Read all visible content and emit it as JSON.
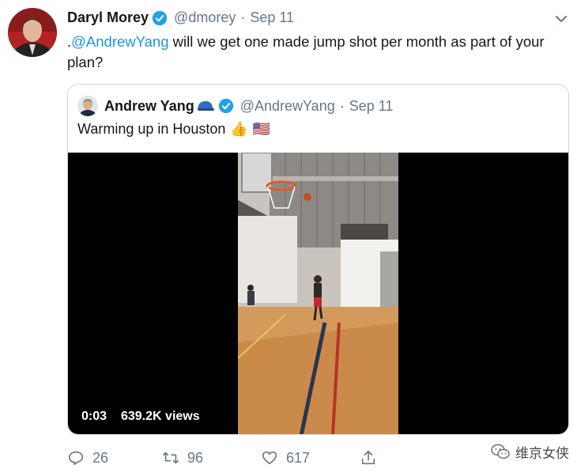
{
  "tweet": {
    "author_name": "Daryl Morey",
    "author_handle": "@dmorey",
    "separator": "·",
    "date": "Sep 11",
    "text_prefix": ".",
    "mention": "@AndrewYang",
    "text_body": " will we get one made jump shot per month as part of your plan?"
  },
  "quoted_tweet": {
    "author_name": "Andrew Yang",
    "author_handle": "@AndrewYang",
    "separator": "·",
    "date": "Sep 11",
    "text": "Warming up in Houston",
    "emoji_1": "👍",
    "emoji_2": "🇺🇸"
  },
  "video": {
    "duration": "0:03",
    "views": "639.2K views"
  },
  "actions": {
    "replies": "26",
    "retweets": "96",
    "likes": "617"
  },
  "watermark": {
    "text": "维京女侠"
  },
  "colors": {
    "link": "#1b95e0",
    "verified": "#1da1f2",
    "secondary_text": "#657786",
    "border": "#ccd6dd"
  },
  "icons": [
    "verified-badge-icon",
    "chevron-down-icon",
    "reply-icon",
    "retweet-icon",
    "like-icon",
    "share-icon",
    "wechat-icon",
    "cap-icon"
  ]
}
